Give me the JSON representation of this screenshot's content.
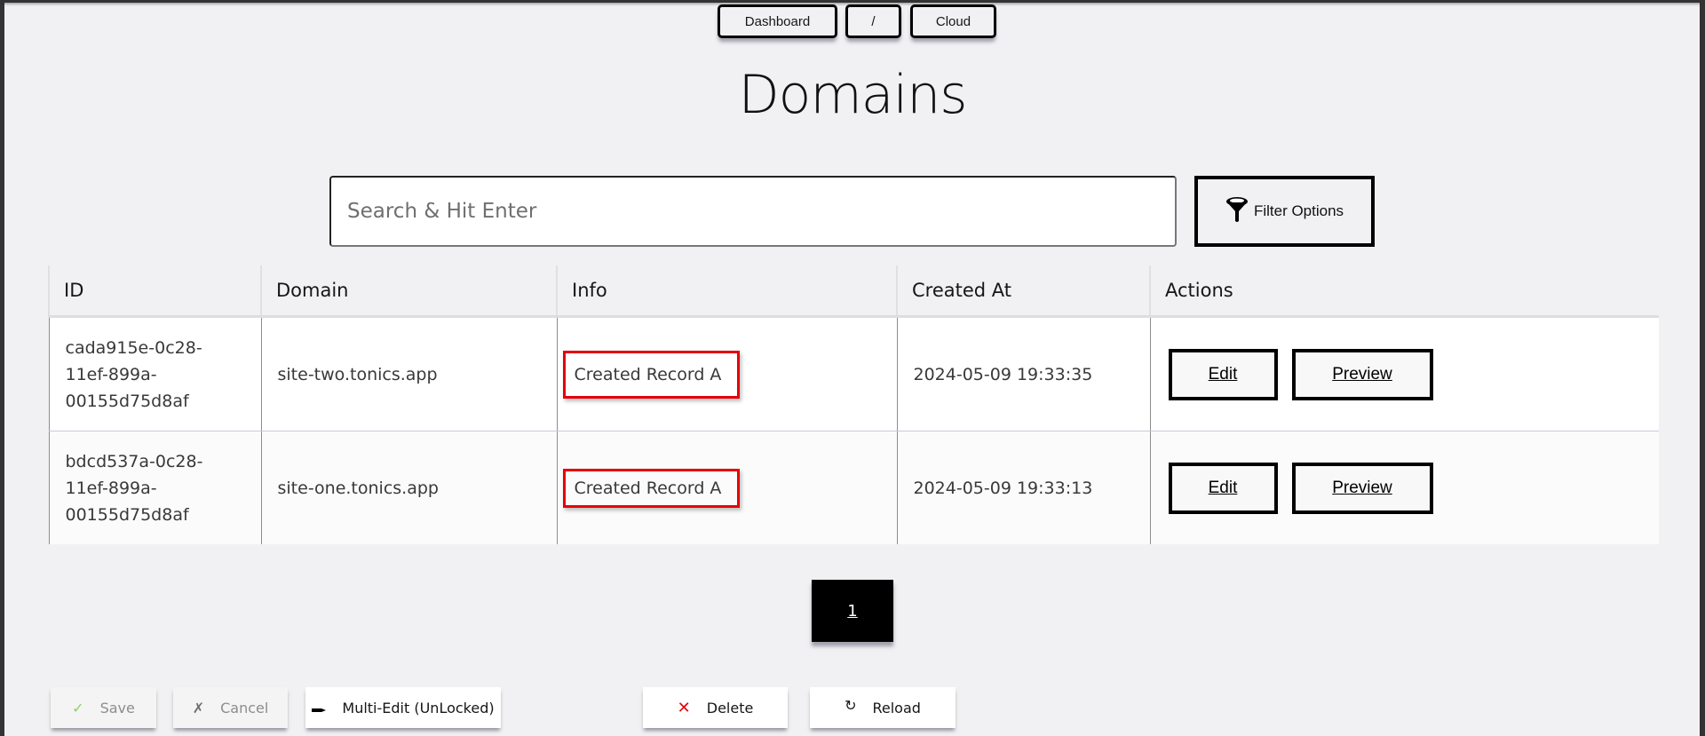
{
  "breadcrumb": {
    "items": [
      {
        "label": "Dashboard"
      },
      {
        "label": "/"
      },
      {
        "label": "Cloud"
      }
    ]
  },
  "page": {
    "title": "Domains"
  },
  "search": {
    "value": "",
    "placeholder": "Search & Hit Enter"
  },
  "filter": {
    "label": "Filter Options",
    "icon": "funnel-icon"
  },
  "table": {
    "columns": [
      "ID",
      "Domain",
      "Info",
      "Created At",
      "Actions"
    ],
    "rows": [
      {
        "id_lines": [
          "cada915e-0c28-",
          "11ef-899a-",
          "00155d75d8af"
        ],
        "domain": "site-two.tonics.app",
        "info": "Created Record A",
        "created_at": "2024-05-09 19:33:35",
        "actions": {
          "edit": "Edit",
          "preview": "Preview"
        }
      },
      {
        "id_lines": [
          "bdcd537a-0c28-",
          "11ef-899a-",
          "00155d75d8af"
        ],
        "domain": "site-one.tonics.app",
        "info": "Created Record A",
        "created_at": "2024-05-09 19:33:13",
        "actions": {
          "edit": "Edit",
          "preview": "Preview"
        }
      }
    ]
  },
  "pagination": {
    "current_page": "1"
  },
  "toolbar": {
    "save": {
      "label": "Save",
      "icon": "✓",
      "enabled": false
    },
    "cancel": {
      "label": "Cancel",
      "icon": "✗",
      "enabled": false
    },
    "multi_edit": {
      "label": "Multi-Edit (UnLocked)",
      "icon": "pen-icon",
      "enabled": true
    },
    "delete": {
      "label": "Delete",
      "icon": "✕",
      "enabled": true
    },
    "reload": {
      "label": "Reload",
      "icon": "↻",
      "enabled": true
    }
  },
  "colors": {
    "info_highlight": "#e5000a",
    "save_check": "#8fd16a",
    "delete_x": "#e5000a",
    "page_bg": "#f1f1f3"
  }
}
